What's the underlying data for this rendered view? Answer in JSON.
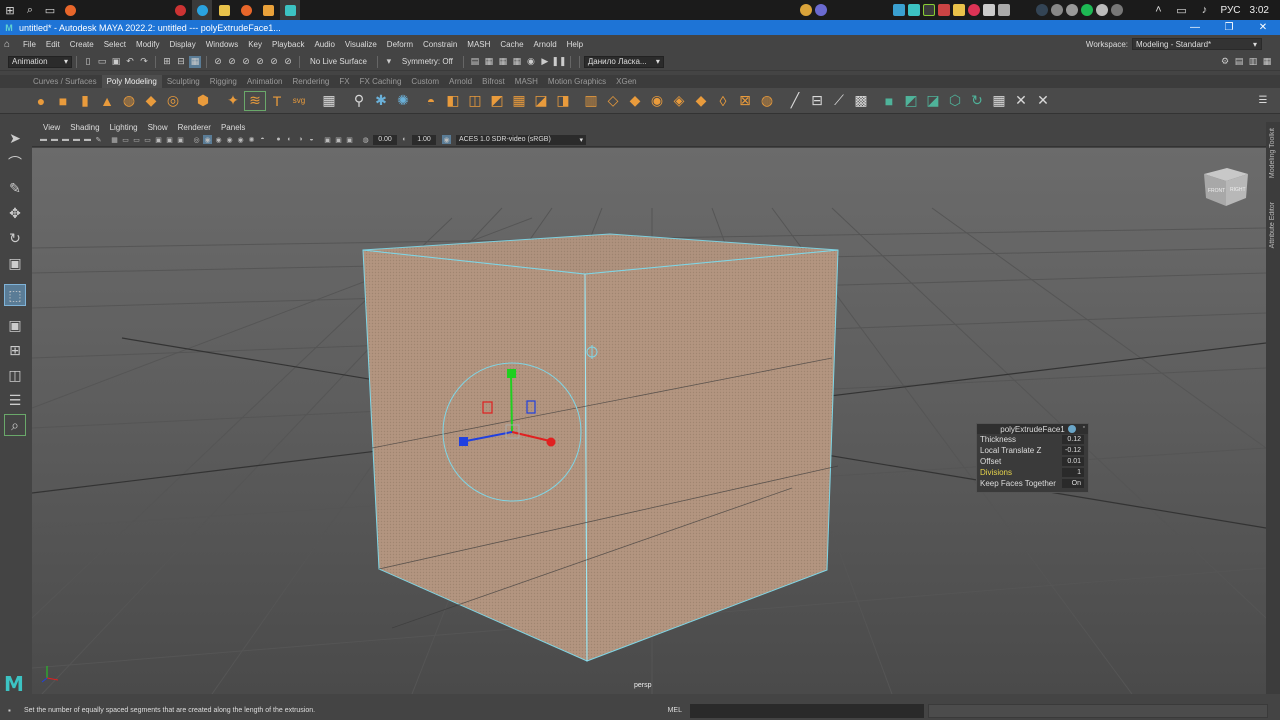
{
  "taskbar": {
    "language": "РУС",
    "time": "3:02"
  },
  "window": {
    "title": "untitled* - Autodesk MAYA 2022.2: untitled   ---   polyExtrudeFace1..."
  },
  "menu": {
    "items": [
      "File",
      "Edit",
      "Create",
      "Select",
      "Modify",
      "Display",
      "Windows",
      "Key",
      "Playback",
      "Audio",
      "Visualize",
      "Deform",
      "Constrain",
      "MASH",
      "Cache",
      "Arnold",
      "Help"
    ],
    "workspace_label": "Workspace:",
    "workspace_value": "Modeling - Standard*"
  },
  "statusline": {
    "menuset": "Animation",
    "live_surface": "No Live Surface",
    "symmetry": "Symmetry: Off",
    "user": "Данило Ласка..."
  },
  "shelf": {
    "tabs": [
      "Curves / Surfaces",
      "Poly Modeling",
      "Sculpting",
      "Rigging",
      "Animation",
      "Rendering",
      "FX",
      "FX Caching",
      "Custom",
      "Arnold",
      "Bifrost",
      "MASH",
      "Motion Graphics",
      "XGen"
    ],
    "active_tab": "Poly Modeling"
  },
  "panel": {
    "menus": [
      "View",
      "Shading",
      "Lighting",
      "Show",
      "Renderer",
      "Panels"
    ],
    "exposure": "0.00",
    "gamma": "1.00",
    "colorspace": "ACES 1.0 SDR-video (sRGB)",
    "camera_label": "persp",
    "viewcube_front": "FRONT",
    "viewcube_right": "RIGHT"
  },
  "side_tabs": {
    "modeling_toolkit": "Modeling Toolkit",
    "attribute_editor": "Attribute Editor"
  },
  "popup": {
    "title": "polyExtrudeFace1",
    "rows": [
      {
        "label": "Thickness",
        "value": "0.12"
      },
      {
        "label": "Local Translate Z",
        "value": "-0.12"
      },
      {
        "label": "Offset",
        "value": "0.01"
      },
      {
        "label": "Divisions",
        "value": "1"
      },
      {
        "label": "Keep Faces Together",
        "value": "On"
      }
    ]
  },
  "helpline": {
    "text": "Set the number of equally spaced segments that are created along the length of the extrusion.",
    "mel": "MEL"
  },
  "colors": {
    "title_bar": "#1e74d6",
    "face_fill": "#b39580",
    "wire": "#7fd6e6",
    "gizmo_x": "#e02020",
    "gizmo_y": "#20d020",
    "gizmo_z": "#2040e0",
    "highlight": "#e7d44c"
  }
}
